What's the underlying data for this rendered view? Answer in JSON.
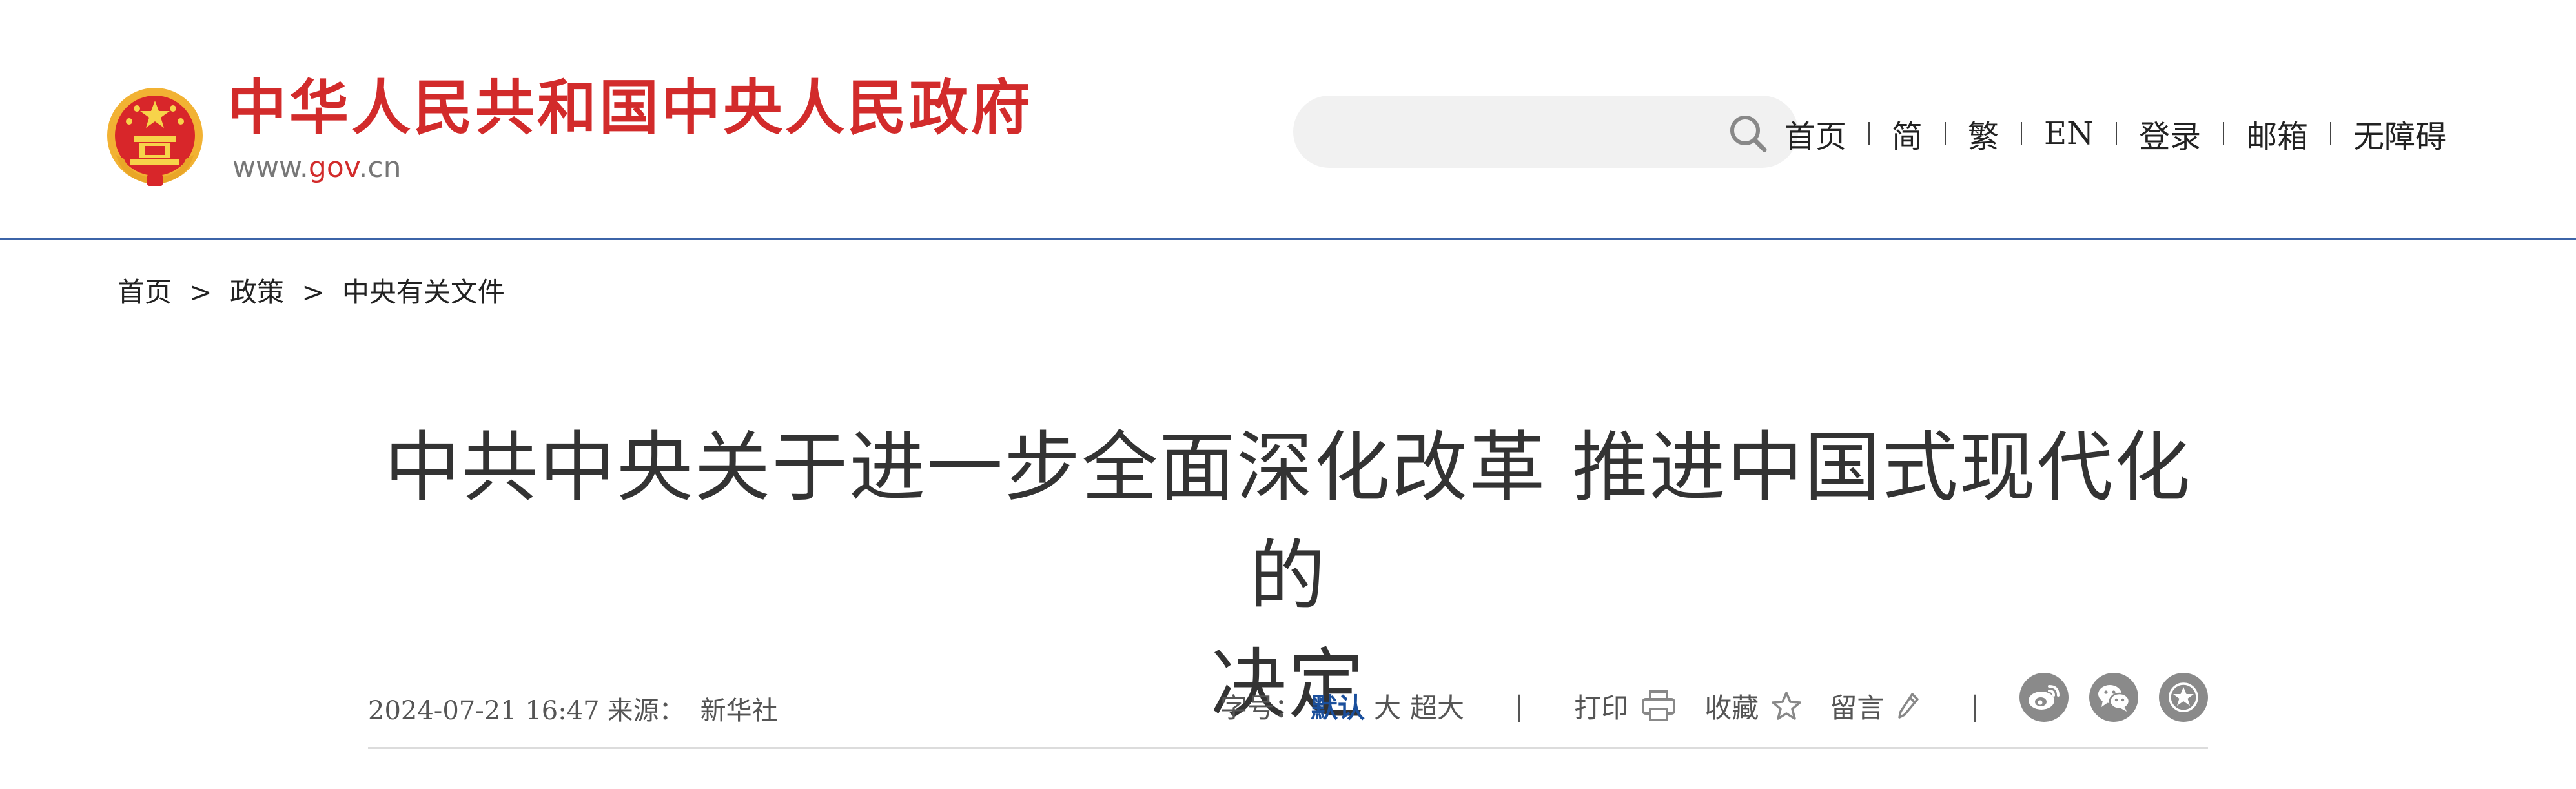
{
  "header": {
    "site_name": "中华人民共和国中央人民政府",
    "site_url_prefix": "www.",
    "site_url_domain": "gov",
    "site_url_suffix": ".cn",
    "search": {
      "placeholder": ""
    },
    "nav": {
      "home": "首页",
      "simplified": "简",
      "traditional": "繁",
      "english": "EN",
      "login": "登录",
      "mailbox": "邮箱",
      "accessibility": "无障碍"
    }
  },
  "breadcrumb": {
    "items": [
      "首页",
      "政策",
      "中央有关文件"
    ],
    "separator": ">"
  },
  "article": {
    "title_line1": "中共中央关于进一步全面深化改革 推进中国式现代化的",
    "title_line2": "决定",
    "datetime": "2024-07-21 16:47",
    "source_label": "来源：",
    "source_value": "新华社"
  },
  "tools": {
    "font_size_label": "字号：",
    "font_default": "默认",
    "font_large": "大",
    "font_xlarge": "超大",
    "divider": "|",
    "print": "打印",
    "favorite": "收藏",
    "comment": "留言"
  },
  "colors": {
    "brand_red": "#d22b2b",
    "header_border": "#3c64a8",
    "active_font_option": "#1a4f9c",
    "share_icon_bg": "#8a8a8a"
  },
  "icons": {
    "emblem": "national-emblem-icon",
    "search": "search-icon",
    "print": "printer-icon",
    "favorite": "star-outline-icon",
    "comment": "pencil-icon",
    "share": [
      "weibo-icon",
      "wechat-icon",
      "party-star-icon"
    ]
  }
}
